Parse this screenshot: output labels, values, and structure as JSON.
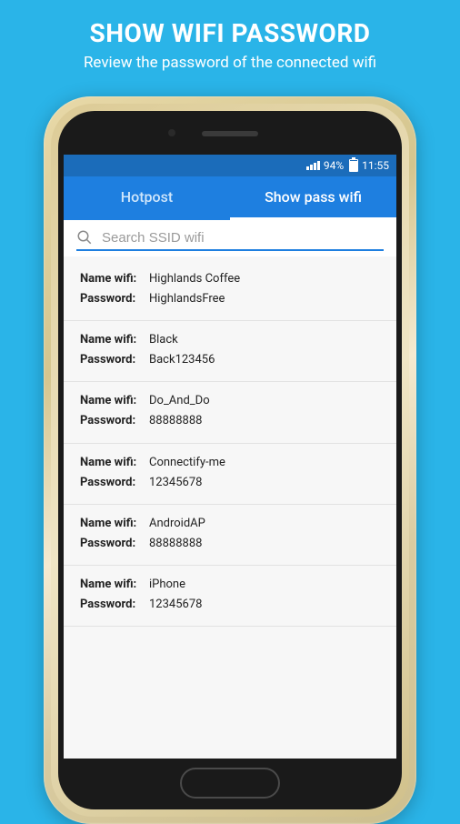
{
  "promo": {
    "title": "SHOW WIFI PASSWORD",
    "subtitle": "Review the password of the connected wifi"
  },
  "status": {
    "battery": "94%",
    "time": "11:55"
  },
  "tabs": [
    {
      "label": "Hotpost",
      "active": false
    },
    {
      "label": "Show pass wifi",
      "active": true
    }
  ],
  "search": {
    "placeholder": "Search SSID wifi"
  },
  "labels": {
    "name": "Name wifi:",
    "password": "Password:"
  },
  "networks": [
    {
      "name": "Highlands Coffee",
      "password": "HighlandsFree"
    },
    {
      "name": "Black",
      "password": "Back123456"
    },
    {
      "name": "Do_And_Do",
      "password": "88888888"
    },
    {
      "name": "Connectify-me",
      "password": "12345678"
    },
    {
      "name": "AndroidAP",
      "password": "88888888"
    },
    {
      "name": "iPhone",
      "password": "12345678"
    }
  ]
}
